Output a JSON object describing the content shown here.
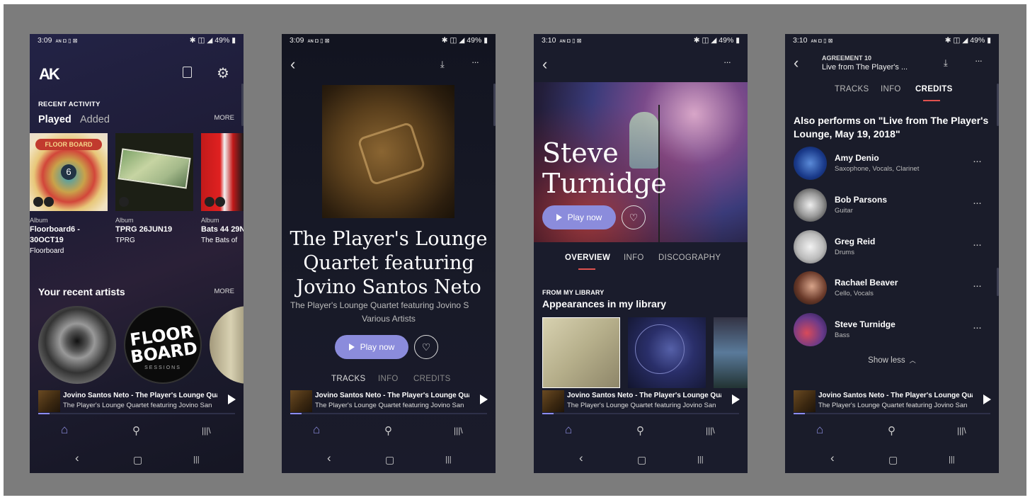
{
  "phone1": {
    "status": {
      "time": "3:09",
      "left_icons": "ᴀɴ ◘ ▯ ⊠",
      "right": "✱ ◫ ◢ 49% ▮"
    },
    "logo": "AK",
    "recent_activity_label": "RECENT ACTIVITY",
    "tab_played": "Played",
    "tab_added": "Added",
    "more_1": "MORE",
    "albums": [
      {
        "type": "Album",
        "title": "Floorboard6 -",
        "title2": "30OCT19",
        "artist": "Floorboard"
      },
      {
        "type": "Album",
        "title": "TPRG 26JUN19",
        "title2": "",
        "artist": "TPRG"
      },
      {
        "type": "Album",
        "title": "Bats 44 29N",
        "title2": "",
        "artist": "The Bats of"
      }
    ],
    "recent_artists_label": "Your recent artists",
    "more_2": "MORE",
    "floor_text": "FLOOR BOARD",
    "floor_sub": "SESSIONS"
  },
  "phone2": {
    "status": {
      "time": "3:09",
      "left_icons": "ᴀɴ ◘ ▯ ⊠",
      "right": "✱ ◫ ◢ 49% ▮"
    },
    "title_lines": [
      "The Player's Lounge",
      "Quartet featuring",
      "Jovino Santos Neto"
    ],
    "subtitle": "The Player's Lounge Quartet featuring Jovino S",
    "subtitle2": "Various Artists",
    "play_label": "Play now",
    "tabs": [
      "TRACKS",
      "INFO",
      "CREDITS"
    ]
  },
  "phone3": {
    "status": {
      "time": "3:10",
      "left_icons": "ᴀɴ ◘ ▯ ⊠",
      "right": "✱ ◫ ◢ 49% ▮"
    },
    "artist_line1": "Steve",
    "artist_line2": "Turnidge",
    "play_label": "Play now",
    "tabs": [
      "OVERVIEW",
      "INFO",
      "DISCOGRAPHY"
    ],
    "library_label": "FROM MY LIBRARY",
    "library_title": "Appearances in my library"
  },
  "phone4": {
    "status": {
      "time": "3:10",
      "left_icons": "ᴀɴ ◘ ▯ ⊠",
      "right": "✱ ◫ ◢ 49% ▮"
    },
    "header_small": "AGREEMENT 10",
    "header_title": "Live from The Player's ...",
    "tabs": [
      "TRACKS",
      "INFO",
      "CREDITS"
    ],
    "section_title_1": "Also performs on \"Live from The Player's",
    "section_title_2": "Lounge, May 19, 2018\"",
    "credits": [
      {
        "name": "Amy Denio",
        "role": "Saxophone, Vocals, Clarinet"
      },
      {
        "name": "Bob Parsons",
        "role": "Guitar"
      },
      {
        "name": "Greg Reid",
        "role": "Drums"
      },
      {
        "name": "Rachael Beaver",
        "role": "Cello, Vocals"
      },
      {
        "name": "Steve Turnidge",
        "role": "Bass"
      }
    ],
    "show_less": "Show less"
  },
  "mini_player": {
    "track": "Jovino Santos Neto - The Player's Lounge Quarte",
    "album": "The Player's Lounge Quartet featuring Jovino San"
  },
  "icons": {
    "back": "‹",
    "download": "⤓",
    "more": "···",
    "home": "⌂",
    "search": "⚲",
    "library": "|||\\",
    "nav_back": "‹",
    "nav_home": "▢",
    "nav_recents": "|||"
  },
  "colors": {
    "accent": "#8b8cdc",
    "tab_underline": "#e0524f",
    "background": "#7c7c7c"
  }
}
